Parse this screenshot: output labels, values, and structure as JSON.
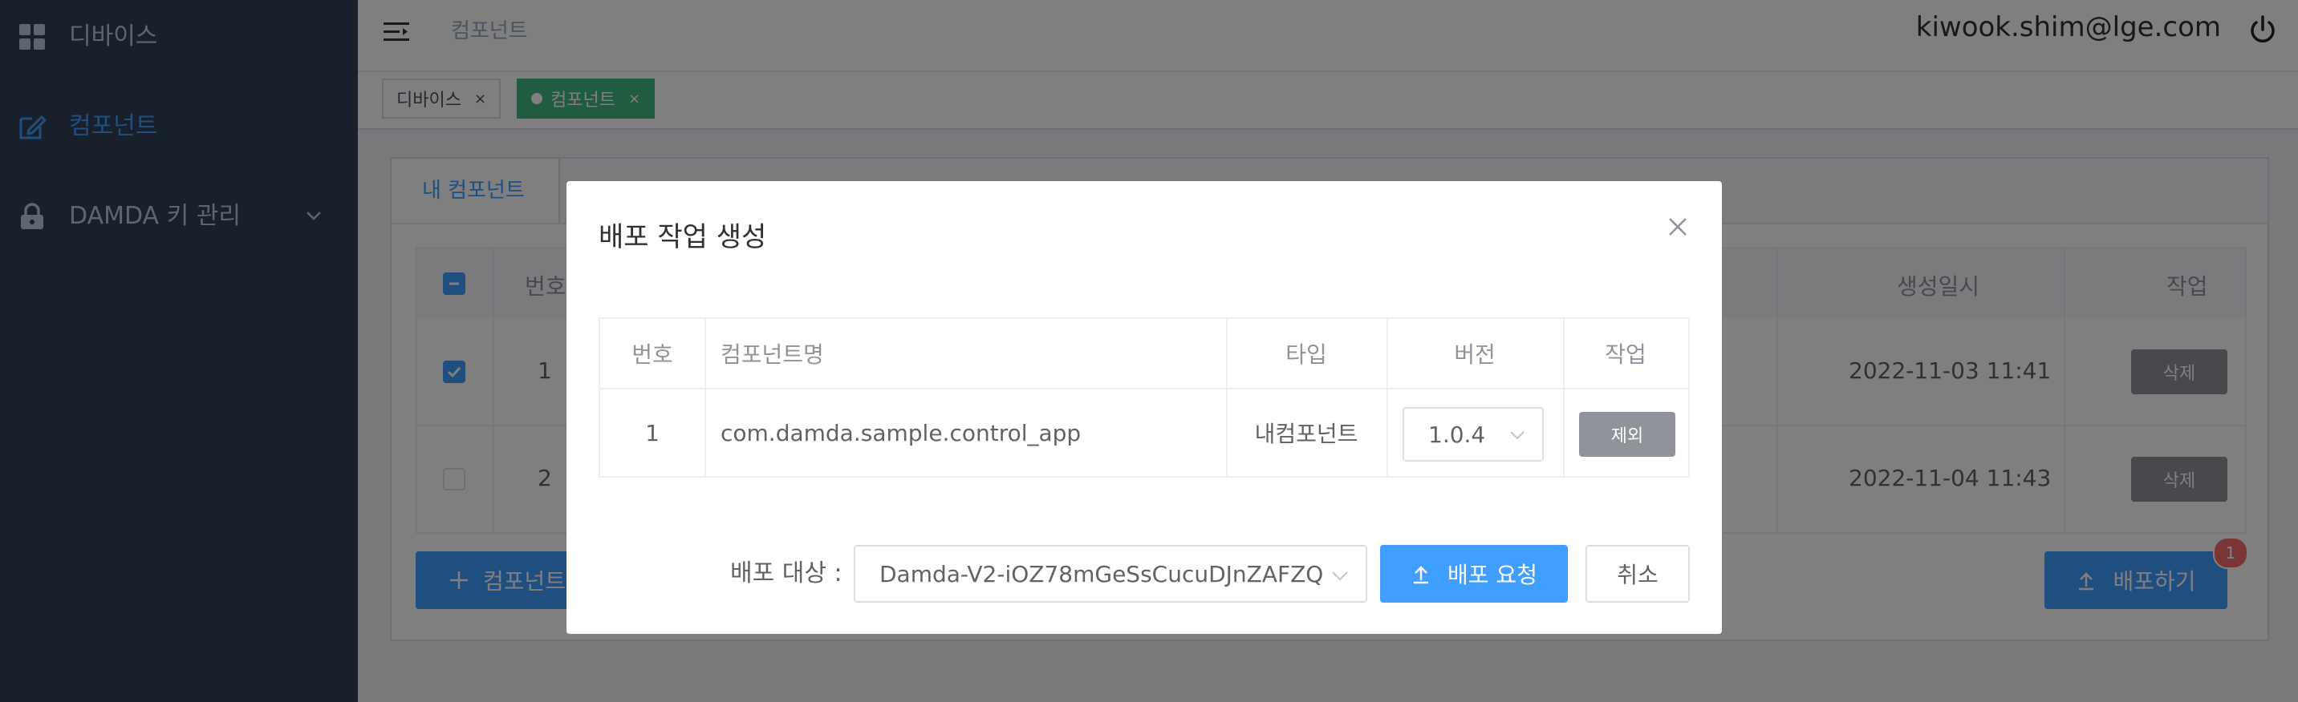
{
  "sidebar": {
    "items": [
      {
        "label": "디바이스",
        "icon": "grid-icon"
      },
      {
        "label": "컴포넌트",
        "icon": "edit-icon",
        "active": true
      },
      {
        "label": "DAMDA 키 관리",
        "icon": "lock-icon"
      }
    ]
  },
  "navbar": {
    "breadcrumb": "컴포넌트",
    "user_email": "kiwook.shim@lge.com"
  },
  "tags": [
    {
      "label": "디바이스",
      "close": "×"
    },
    {
      "label": "컴포넌트",
      "close": "×",
      "active": true
    }
  ],
  "card": {
    "tab_label": "내 컴포넌트",
    "table": {
      "headers": {
        "number": "번호",
        "created": "생성일시",
        "action": "작업"
      },
      "rows": [
        {
          "number": "1",
          "created": "2022-11-03 11:41",
          "action": "삭제",
          "checked": true
        },
        {
          "number": "2",
          "created": "2022-11-04 11:43",
          "action": "삭제",
          "checked": false
        }
      ]
    },
    "add_button": "컴포넌트",
    "deploy_button": "배포하기",
    "deploy_badge": "1"
  },
  "dialog": {
    "title": "배포 작업 생성",
    "table": {
      "headers": [
        "번호",
        "컴포넌트명",
        "타입",
        "버전",
        "작업"
      ],
      "rows": [
        {
          "number": "1",
          "name": "com.damda.sample.control_app",
          "type": "내컴포넌트",
          "version": "1.0.4",
          "action": "제외"
        }
      ]
    },
    "target_label": "배포 대상 :",
    "target_value": "Damda-V2-iOZ78mGeSsCucuDJnZAFZQ",
    "request_button": "배포 요청",
    "cancel_button": "취소"
  },
  "colors": {
    "sidebar_bg": "#304156",
    "primary": "#409eff",
    "tag_active": "#42b983",
    "badge": "#f56c6c",
    "gray_button": "#909399"
  }
}
